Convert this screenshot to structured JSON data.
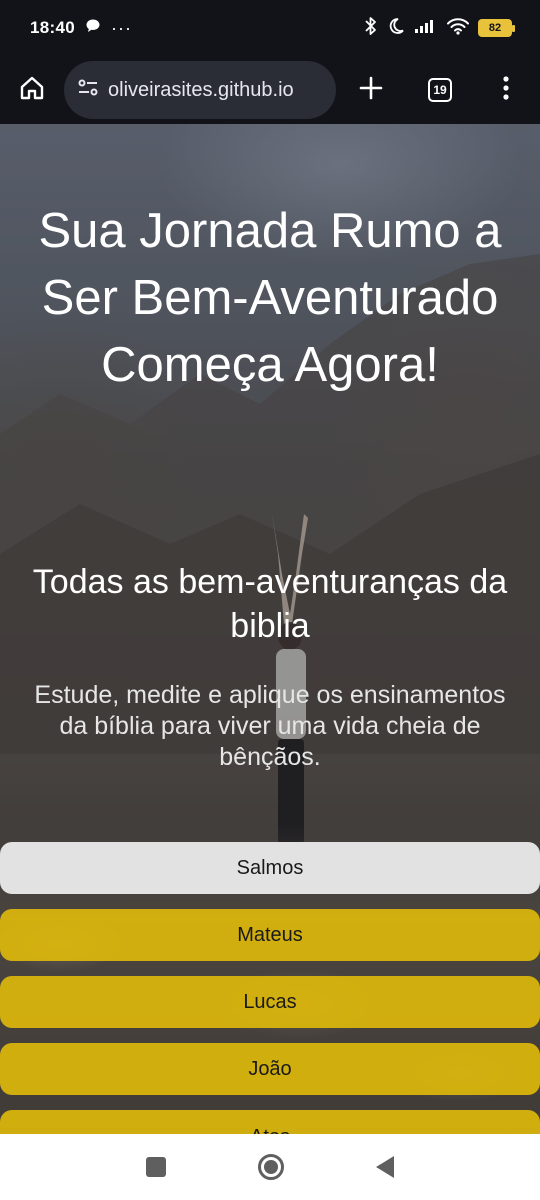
{
  "status_bar": {
    "time": "18:40",
    "more_indicator": "···",
    "battery_level": "82"
  },
  "browser": {
    "url": "oliveirasites.github.io",
    "tab_count": "19"
  },
  "hero": {
    "title": "Sua Jornada Rumo a Ser Bem-Aventurado Começa Agora!",
    "subtitle": "Todas as bem-aventuranças da biblia",
    "description": "Estude, medite e aplique os ensinamentos da bíblia para viver uma vida cheia de bênçãos."
  },
  "books": [
    {
      "label": "Salmos",
      "state": "selected"
    },
    {
      "label": "Mateus",
      "state": "default"
    },
    {
      "label": "Lucas",
      "state": "default"
    },
    {
      "label": "João",
      "state": "default"
    },
    {
      "label": "Atos",
      "state": "default"
    }
  ],
  "colors": {
    "accent_gold": "#e0ba0a",
    "selected_button": "#e2e2e2",
    "toolbar_bg": "#121318",
    "url_pill_bg": "#2a2c36"
  }
}
